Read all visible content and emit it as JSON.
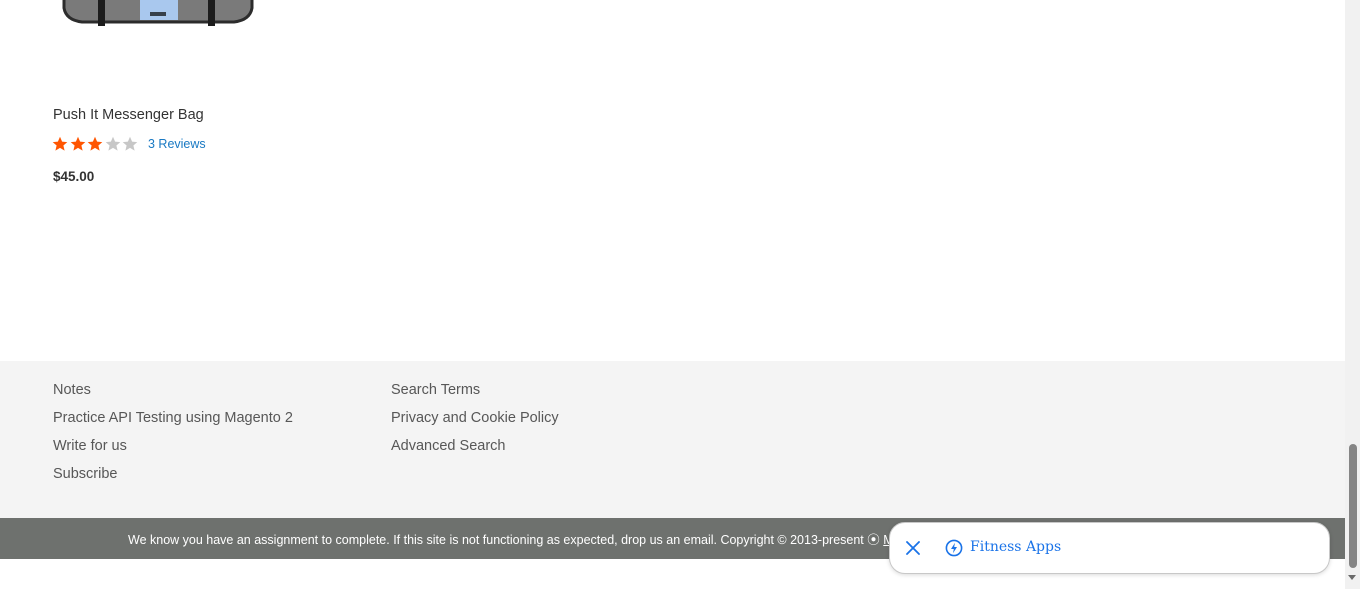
{
  "product": {
    "name": "Push It Messenger Bag",
    "rating_percent": 60,
    "star_count": 5,
    "reviews_label": "3 Reviews",
    "price": "$45.00",
    "rating_color": "#ff5501"
  },
  "footer": {
    "col1": [
      "Notes",
      "Practice API Testing using Magento 2",
      "Write for us",
      "Subscribe"
    ],
    "col2": [
      "Search Terms",
      "Privacy and Cookie Policy",
      "Advanced Search"
    ]
  },
  "copyright": {
    "text": "We know you have an assignment to complete. If this site is not functioning as expected, drop us an email. Copyright © 2013-present",
    "symbol": "⦿",
    "link_text": "M"
  },
  "popup": {
    "close_icon": "close-icon",
    "app_icon": "bolt-icon",
    "label": "Fitness Apps",
    "accent": "#1a73e8"
  }
}
